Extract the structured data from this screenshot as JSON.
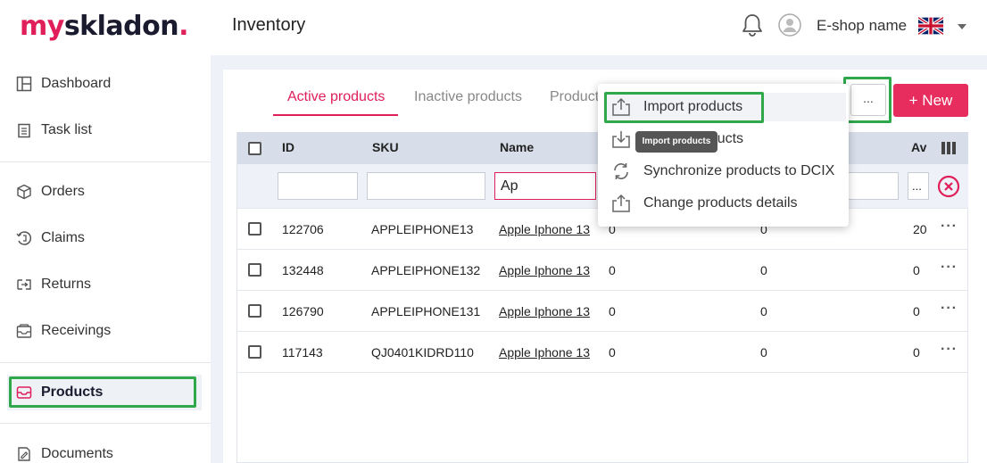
{
  "header": {
    "logo": {
      "part1": "my",
      "part2": "skladon",
      "part3": "."
    },
    "title": "Inventory",
    "shop_name": "E-shop name"
  },
  "sidebar": {
    "items": [
      {
        "label": "Dashboard",
        "icon": "dashboard-icon"
      },
      {
        "label": "Task list",
        "icon": "task-list-icon"
      },
      {
        "label": "Orders",
        "icon": "box-icon"
      },
      {
        "label": "Claims",
        "icon": "claims-icon"
      },
      {
        "label": "Returns",
        "icon": "returns-icon"
      },
      {
        "label": "Receivings",
        "icon": "receivings-icon"
      },
      {
        "label": "Products",
        "icon": "inbox-icon",
        "active": true
      },
      {
        "label": "Documents",
        "icon": "documents-icon"
      }
    ]
  },
  "tabs": [
    {
      "label": "Active products"
    },
    {
      "label": "Inactive products"
    },
    {
      "label": "Product"
    }
  ],
  "toolbar": {
    "more_label": "...",
    "new_label": "+ New"
  },
  "table": {
    "headers": {
      "id": "ID",
      "sku": "SKU",
      "name": "Name",
      "av": "Av"
    },
    "filters": {
      "name_value": "Ap",
      "more_label": "..."
    },
    "rows": [
      {
        "id": "122706",
        "sku": "APPLEIPHONE13",
        "name": "Apple Iphone 13",
        "c1": "0",
        "c2": "0",
        "av": "20"
      },
      {
        "id": "132448",
        "sku": "APPLEIPHONE132",
        "name": "Apple Iphone 13",
        "c1": "0",
        "c2": "0",
        "av": "0"
      },
      {
        "id": "126790",
        "sku": "APPLEIPHONE131",
        "name": "Apple Iphone 13",
        "c1": "0",
        "c2": "0",
        "av": "0"
      },
      {
        "id": "117143",
        "sku": "QJ0401KIDRD110",
        "name": "Apple Iphone 13",
        "c1": "0",
        "c2": "0",
        "av": "0"
      }
    ],
    "row_more": "···"
  },
  "menu": {
    "items": [
      {
        "label": "Import products",
        "icon": "upload-icon"
      },
      {
        "label": "Export products",
        "icon": "download-icon"
      },
      {
        "label": "Synchronize products to DCIX",
        "icon": "sync-icon"
      },
      {
        "label": "Change products details",
        "icon": "upload-icon"
      }
    ],
    "tooltip": "Import products"
  },
  "colors": {
    "accent": "#e01e5a",
    "highlight": "#2ea84a",
    "header_bg": "#d7deea"
  }
}
